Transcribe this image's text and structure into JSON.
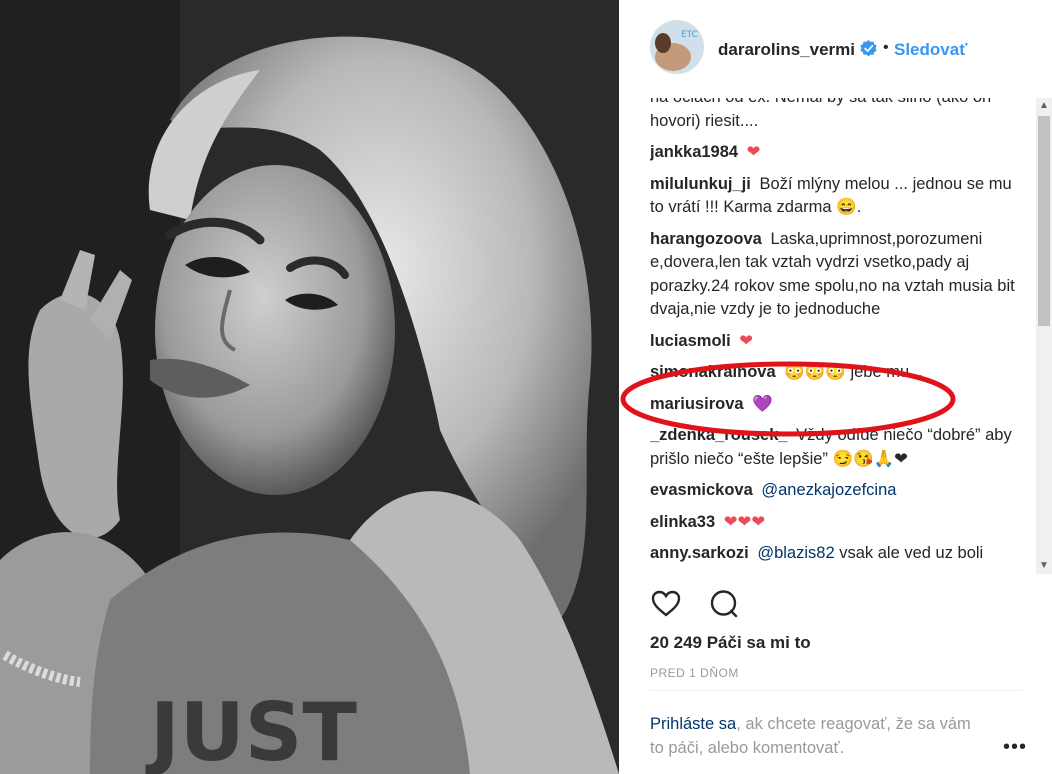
{
  "colors": {
    "link": "#3897f0",
    "mention": "#003569",
    "heart": "#ed4956",
    "annotation": "#e0131a"
  },
  "post": {
    "image_alt": "black and white selfie portrait",
    "username": "dararolins_vermi",
    "follow_label": "Sledovať",
    "separator": "•"
  },
  "comments": [
    {
      "user": "",
      "text": "na ociach od ex. Nemal by sa tak silno (ako on hovori) riesit...."
    },
    {
      "user": "jankka1984",
      "text": "",
      "emoji": "❤"
    },
    {
      "user": "milulunkuj_ji",
      "text": "Boží mlýny melou ... jednou se mu to vrátí !!! Karma zdarma",
      "emoji": "😄."
    },
    {
      "user": "harangozoova",
      "text": "Laska,uprimnost,porozumeni e,dovera,len tak vztah vydrzi vsetko,pady aj porazky.24 rokov sme spolu,no na vztah musia bit dvaja,nie vzdy je to jednoduche"
    },
    {
      "user": "luciasmoli",
      "text": "",
      "emoji": "❤"
    },
    {
      "user": "simonakrainova",
      "text": "jebe mu...",
      "emoji_prefix": "😳😳😳"
    },
    {
      "user": "mariusirova",
      "text": "",
      "emoji": "💜"
    },
    {
      "user": "_zdenka_rousek_",
      "text": "Vždy odíde niečo “dobré” aby prišlo niečo “ešte lepšie”",
      "emoji": "😏😘🙏❤"
    },
    {
      "user": "evasmickova",
      "mention": "@anezkajozefcina"
    },
    {
      "user": "elinka33",
      "text": "",
      "emoji": "❤❤❤"
    },
    {
      "user": "anny.sarkozi",
      "mention": "@blazis82",
      "text": "vsak ale ved uz boli"
    }
  ],
  "actions": {
    "like_icon": "heart-outline-icon",
    "comment_icon": "speech-bubble-icon"
  },
  "likes": "20 249 Páči sa mi to",
  "timestamp": "PRED 1 DŇOM",
  "login_prompt": {
    "link": "Prihláste sa",
    "text": ", ak chcete reagovať, že sa vám to páči, alebo komentovať."
  },
  "more_label": "•••",
  "avatar_badge": "ETC"
}
